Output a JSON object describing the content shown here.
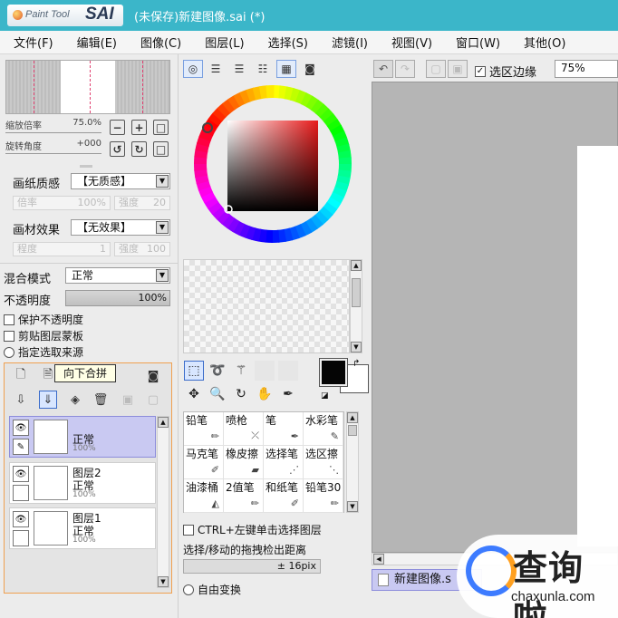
{
  "app": {
    "logo_small": "Paint Tool",
    "logo_big": "SAI",
    "window_title": "(未保存)新建图像.sai (*)"
  },
  "menu": [
    "文件(F)",
    "编辑(E)",
    "图像(C)",
    "图层(L)",
    "选择(S)",
    "滤镜(I)",
    "视图(V)",
    "窗口(W)",
    "其他(O)"
  ],
  "navigator": {
    "zoom_label": "缩放倍率",
    "zoom_value": "75.0%",
    "rotate_label": "旋转角度",
    "rotate_value": "+000"
  },
  "texture": {
    "paper_label": "画纸质感",
    "paper_value": "【无质感】",
    "scale_label": "倍率",
    "scale_value": "100%",
    "strength_label": "强度",
    "strength_value": "20",
    "effect_label": "画材效果",
    "effect_value": "【无效果】",
    "degree_label": "程度",
    "degree_value": "1",
    "effect_strength_label": "强度",
    "effect_strength_value": "100"
  },
  "layer_props": {
    "blend_label": "混合模式",
    "blend_value": "正常",
    "opacity_label": "不透明度",
    "opacity_value": "100%",
    "protect_opacity": "保护不透明度",
    "clip_mask": "剪贴图层蒙板",
    "select_source": "指定选取来源"
  },
  "layers": {
    "tooltip": "向下合拼",
    "items": [
      {
        "name": "",
        "mode": "正常",
        "opacity": "100%"
      },
      {
        "name": "图层2",
        "mode": "正常",
        "opacity": "100%"
      },
      {
        "name": "图层1",
        "mode": "正常",
        "opacity": "100%"
      }
    ]
  },
  "brushes": [
    {
      "name": "铅笔",
      "icon": "pencil-icon"
    },
    {
      "name": "喷枪",
      "icon": "airbrush-icon"
    },
    {
      "name": "笔",
      "icon": "pen-icon"
    },
    {
      "name": "水彩笔",
      "icon": "watercolor-icon"
    },
    {
      "name": "马克笔",
      "icon": "marker-icon"
    },
    {
      "name": "橡皮擦",
      "icon": "eraser-icon"
    },
    {
      "name": "选择笔",
      "icon": "select-pen-icon"
    },
    {
      "name": "选区擦",
      "icon": "select-eraser-icon"
    },
    {
      "name": "油漆桶",
      "icon": "bucket-icon"
    },
    {
      "name": "2值笔",
      "icon": "binary-pen-icon"
    },
    {
      "name": "和纸笔",
      "icon": "washi-pen-icon"
    },
    {
      "name": "铅笔30",
      "icon": "pencil30-icon"
    }
  ],
  "tool_options": {
    "ctrl_select": "CTRL+左键单击选择图层",
    "drag_label": "选择/移动的拖拽检出距离",
    "drag_value": "± 16pix",
    "free_transform": "自由变换"
  },
  "canvas_toolbar": {
    "selection_edge": "选区边缘",
    "zoom": "75%"
  },
  "document_tab": "新建图像.s",
  "watermark": {
    "title": "查询啦",
    "url": "chaxunla.com"
  },
  "colors": {
    "titlebar": "#3bb6c9",
    "selection": "#c9c9f2",
    "accent": "#3a6bc9"
  }
}
